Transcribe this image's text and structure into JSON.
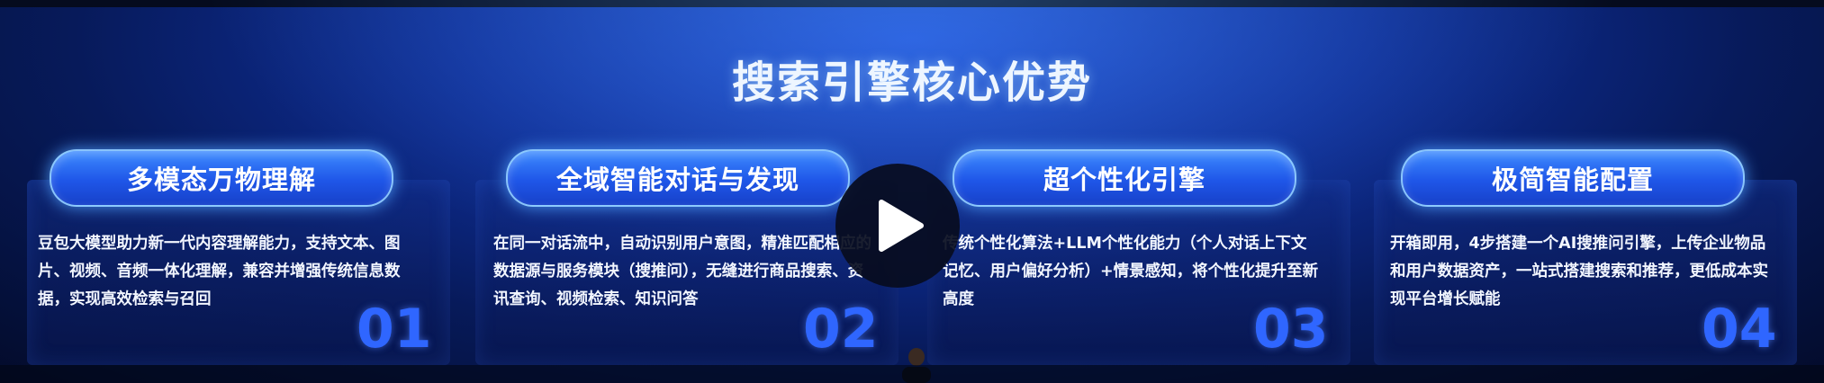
{
  "title": "搜索引擎核心优势",
  "cards": [
    {
      "label": "多模态万物理解",
      "description": "豆包大模型助力新一代内容理解能力，支持文本、图片、视频、音频一体化理解，兼容并增强传统信息数据，实现高效检索与召回",
      "number": "01"
    },
    {
      "label": "全域智能对话与发现",
      "description": "在同一对话流中，自动识别用户意图，精准匹配相应的数据源与服务模块（搜推问），无缝进行商品搜索、资讯查询、视频检索、知识问答",
      "number": "02"
    },
    {
      "label": "超个性化引擎",
      "description": "传统个性化算法+LLM个性化能力（个人对话上下文记忆、用户偏好分析）+情景感知，将个性化提升至新高度",
      "number": "03"
    },
    {
      "label": "极简智能配置",
      "description": "开箱即用，4步搭建一个AI搜推问引擎，上传企业物品和用户数据资产，一站式搭建搜索和推荐，更低成本实现平台增长赋能",
      "number": "04"
    }
  ],
  "play_icon": "play-icon",
  "colors": {
    "accent": "#2f66ff",
    "pill": "#1f56e8",
    "background": "#0f2f9a"
  }
}
